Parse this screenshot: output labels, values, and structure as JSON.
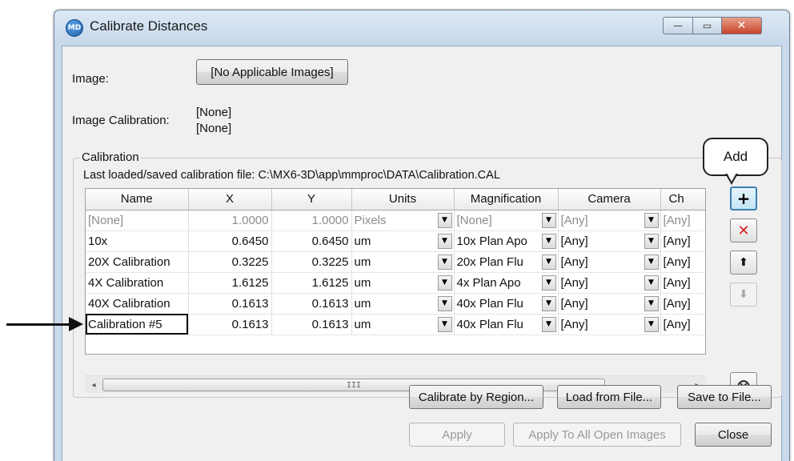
{
  "window": {
    "title": "Calibrate Distances",
    "icon_text": "MD",
    "min_glyph": "—",
    "max_glyph": "▭",
    "close_glyph": "✕"
  },
  "image": {
    "label": "Image:",
    "button": "[No Applicable Images]"
  },
  "image_calibration": {
    "label": "Image Calibration:",
    "value_1": "[None]",
    "value_2": "[None]"
  },
  "calibration": {
    "group_label": "Calibration",
    "last_file_text": "Last loaded/saved calibration file: C:\\MX6-3D\\app\\mmproc\\DATA\\Calibration.CAL",
    "columns": [
      "Name",
      "X",
      "Y",
      "Units",
      "Magnification",
      "Camera",
      "Ch"
    ],
    "rows": [
      {
        "name": "[None]",
        "x": "1.0000",
        "y": "1.0000",
        "units": "Pixels",
        "magnification": "[None]",
        "camera": "[Any]",
        "ch": "[Any]"
      },
      {
        "name": "10x",
        "x": "0.6450",
        "y": "0.6450",
        "units": "um",
        "magnification": "10x Plan Apo",
        "camera": "[Any]",
        "ch": "[Any]"
      },
      {
        "name": "20X Calibration",
        "x": "0.3225",
        "y": "0.3225",
        "units": "um",
        "magnification": "20x Plan Flu",
        "camera": "[Any]",
        "ch": "[Any]"
      },
      {
        "name": "4X Calibration",
        "x": "1.6125",
        "y": "1.6125",
        "units": "um",
        "magnification": "4x Plan Apo",
        "camera": "[Any]",
        "ch": "[Any]"
      },
      {
        "name": "40X Calibration",
        "x": "0.1613",
        "y": "0.1613",
        "units": "um",
        "magnification": "40x Plan Flu",
        "camera": "[Any]",
        "ch": "[Any]"
      },
      {
        "name": "Calibration #5",
        "x": "0.1613",
        "y": "0.1613",
        "units": "um",
        "magnification": "40x Plan Flu",
        "camera": "[Any]",
        "ch": "[Any]"
      }
    ],
    "dropdown_glyph": "▼",
    "scroll_left": "◂",
    "scroll_right": "▸",
    "scroll_grip": "III"
  },
  "side_buttons": {
    "add": "+",
    "delete": "✕",
    "up": "⬆",
    "down": "⬇",
    "clear": "⨂"
  },
  "callout": "Add",
  "buttons": {
    "calibrate_by_region": "Calibrate by Region...",
    "load_from_file": "Load from File...",
    "save_to_file": "Save to File...",
    "apply": "Apply",
    "apply_to_all": "Apply To All Open Images",
    "close": "Close"
  }
}
